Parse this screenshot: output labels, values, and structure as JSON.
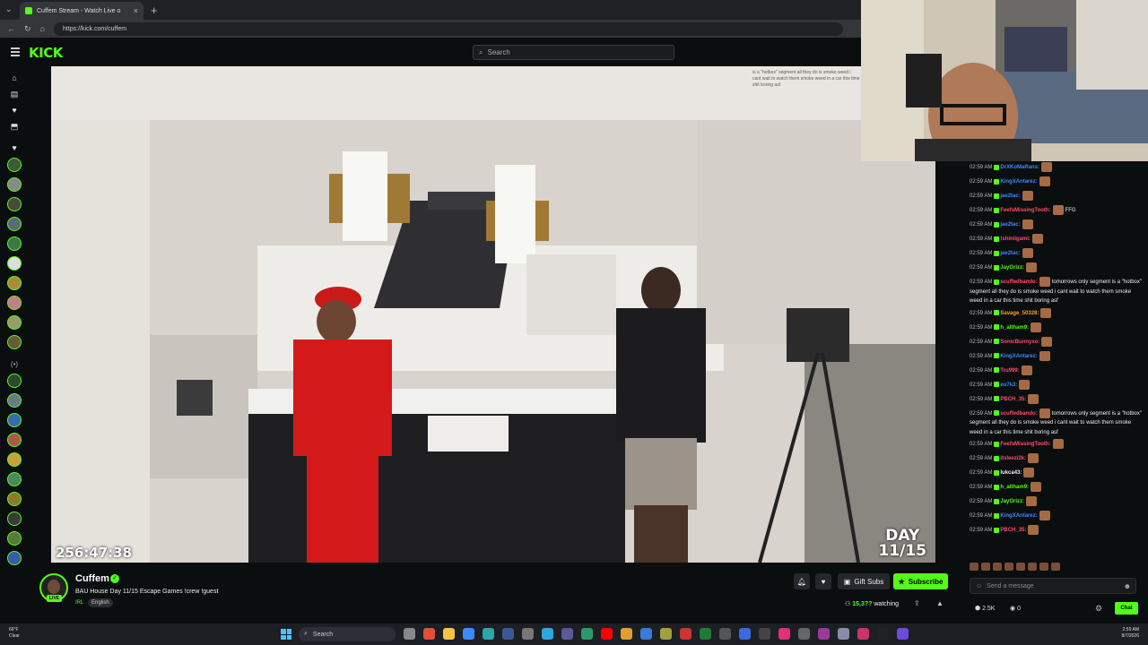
{
  "browser": {
    "tab_title": "Cuffem Stream - Watch Live o",
    "tab_close": "×",
    "new_tab": "+",
    "url": "https://kick.com/cuffem"
  },
  "header": {
    "logo": "KICK",
    "search_placeholder": "Search"
  },
  "video": {
    "timer": "256:47:38",
    "day_badge_line1": "DAY",
    "day_badge_line2": "11/15",
    "overlay_chat": "is a \"hotbox\" segment all they do is smoke weed i cant wait to watch them smoke weed in a car this time shit boring asf"
  },
  "channel": {
    "name": "Cuffem",
    "title": "BAU House Day 11/15 Escape Games !crew !guest",
    "category": "IRL",
    "language": "English",
    "live": "LIVE",
    "gift_subs": "Gift Subs",
    "subscribe": "Subscribe",
    "viewers_count": "15,3??",
    "viewers_label": "watching"
  },
  "chat": {
    "messages": [
      {
        "time": "02:59 AM",
        "user": "DrXKoMaRans:",
        "text": "",
        "color": "#3a8bff"
      },
      {
        "time": "02:59 AM",
        "user": "KingXAntarez:",
        "text": "",
        "color": "#3a8bff"
      },
      {
        "time": "02:59 AM",
        "user": "jae2tac:",
        "text": "",
        "color": "#3a8bff"
      },
      {
        "time": "02:59 AM",
        "user": "FeefsMissingTooth:",
        "text": "FFG",
        "color": "#ff4d6d"
      },
      {
        "time": "02:59 AM",
        "user": "jae2tac:",
        "text": "",
        "color": "#3a8bff"
      },
      {
        "time": "02:59 AM",
        "user": "!shiniigami:",
        "text": "",
        "color": "#ff4d6d"
      },
      {
        "time": "02:59 AM",
        "user": "jae2tac:",
        "text": "",
        "color": "#3a8bff"
      },
      {
        "time": "02:59 AM",
        "user": "JayGrizz:",
        "text": "",
        "color": "#53fc18"
      },
      {
        "time": "02:59 AM",
        "user": "scuffedbando:",
        "text": "tomorrows only segment is a \"hotbox\" segment all they do is smoke weed i cant wait to watch them smoke weed in a car this time shit boring asf",
        "color": "#ff4d6d"
      },
      {
        "time": "02:59 AM",
        "user": "Savage_50328:",
        "text": "",
        "color": "#ff9f1c"
      },
      {
        "time": "02:59 AM",
        "user": "h_altham9:",
        "text": "",
        "color": "#53fc18"
      },
      {
        "time": "02:59 AM",
        "user": "SonicBunnyxo:",
        "text": "",
        "color": "#ff4d6d"
      },
      {
        "time": "02:59 AM",
        "user": "KingXAntarez:",
        "text": "",
        "color": "#3a8bff"
      },
      {
        "time": "02:59 AM",
        "user": "Tru999:",
        "text": "",
        "color": "#ff4d6d"
      },
      {
        "time": "02:59 AM",
        "user": "eu7k3:",
        "text": "",
        "color": "#3a8bff"
      },
      {
        "time": "02:59 AM",
        "user": "PBCH_35:",
        "text": "",
        "color": "#ff4d6d"
      },
      {
        "time": "02:59 AM",
        "user": "scuffedbando:",
        "text": "tomorrows only segment is a \"hotbox\" segment all they do is smoke weed i cant wait to watch them smoke weed in a car this time shit boring asf",
        "color": "#ff4d6d"
      },
      {
        "time": "02:59 AM",
        "user": "FeefsMissingTooth:",
        "text": "",
        "color": "#ff4d6d"
      },
      {
        "time": "02:59 AM",
        "user": "itsleezi2k:",
        "text": "",
        "color": "#ff4d6d"
      },
      {
        "time": "02:59 AM",
        "user": "lukca43:",
        "text": "",
        "color": "#eee"
      },
      {
        "time": "02:59 AM",
        "user": "h_altham9:",
        "text": "",
        "color": "#53fc18"
      },
      {
        "time": "02:59 AM",
        "user": "JayGrizz:",
        "text": "",
        "color": "#53fc18"
      },
      {
        "time": "02:59 AM",
        "user": "KingXAntarez:",
        "text": "",
        "color": "#3a8bff"
      },
      {
        "time": "02:59 AM",
        "user": "PBCH_35:",
        "text": "",
        "color": "#ff4d6d"
      }
    ],
    "input_placeholder": "Send a message",
    "points": "2.5K",
    "kicks": "0",
    "chat_button": "Chat"
  },
  "taskbar": {
    "weather_temp": "66°F",
    "weather_desc": "Clear",
    "search": "Search",
    "time": "2:59 AM",
    "date": "8/7/2026"
  },
  "colors": {
    "accent": "#53fc18",
    "bg": "#0b0e0f"
  }
}
